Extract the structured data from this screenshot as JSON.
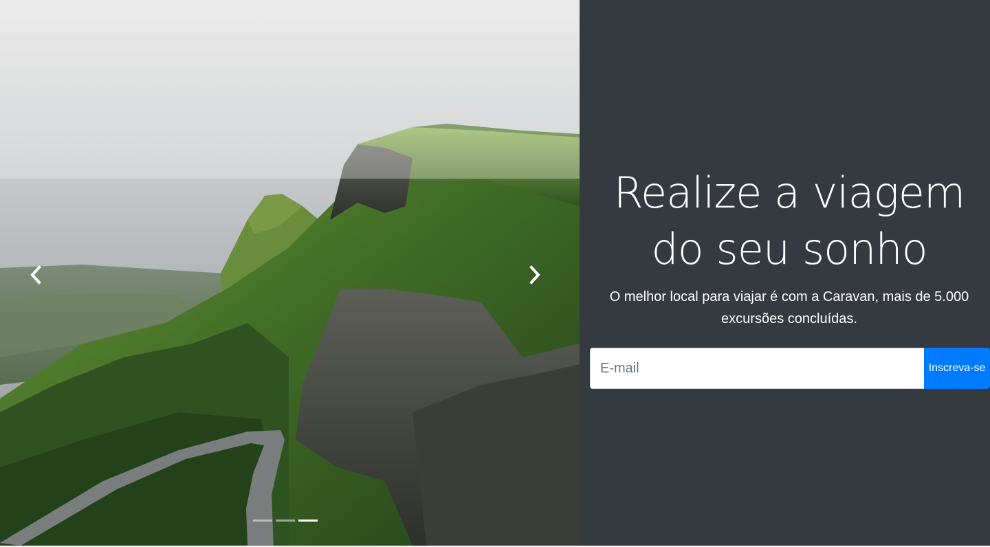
{
  "hero": {
    "title": "Realize a viagem do seu sonho",
    "subtitle": "O melhor local para viajar é com a Caravan, mais de 5.000 excursões concluídas."
  },
  "signup": {
    "email_placeholder": "E-mail",
    "email_value": "",
    "submit_label": "Inscreva-se"
  },
  "carousel": {
    "prev_icon": "chevron-left-icon",
    "next_icon": "chevron-right-icon",
    "slide_count": 3,
    "active_index": 2
  },
  "colors": {
    "panel_bg": "#343a40",
    "accent": "#007bff",
    "text": "#ffffff"
  }
}
